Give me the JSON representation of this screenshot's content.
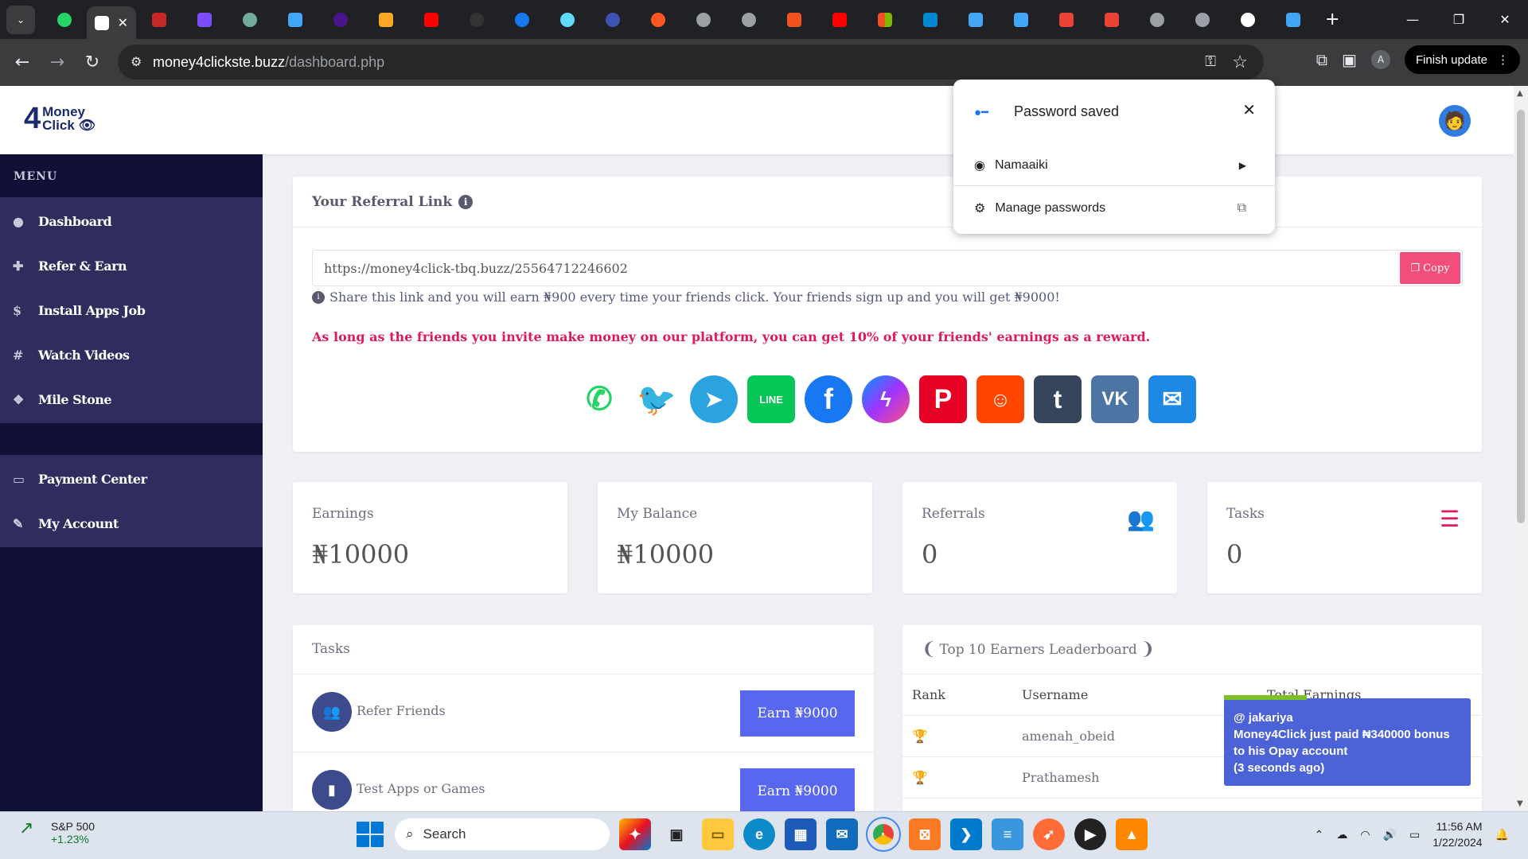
{
  "browser": {
    "active_tab_close": "✕",
    "url_host": "money4clickste.buzz",
    "url_path": "/dashboard.php",
    "profile_initial": "A",
    "finish_update_label": "Finish update"
  },
  "site": {
    "logo_number": "4",
    "logo_word1": "Money",
    "logo_word2": "Click"
  },
  "sidebar": {
    "menu_label": "MENU",
    "items": [
      {
        "label": "Dashboard",
        "icon": "user-circle-icon"
      },
      {
        "label": "Refer & Earn",
        "icon": "user-plus-icon"
      },
      {
        "label": "Install Apps Job",
        "icon": "dollar-icon"
      },
      {
        "label": "Watch Videos",
        "icon": "hash-icon"
      },
      {
        "label": "Mile Stone",
        "icon": "gift-icon"
      }
    ],
    "items2": [
      {
        "label": "Payment Center",
        "icon": "payment-icon"
      },
      {
        "label": "My Account",
        "icon": "wrench-icon"
      }
    ]
  },
  "referral": {
    "title": "Your Referral Link",
    "link": "https://money4click-tbq.buzz/25564712246602",
    "copy_label": "Copy",
    "note": "Share this link and you will earn ₦900 every time your friends click. Your friends sign up and you will get ₦9000!",
    "promo": "As long as the friends you invite make money on our platform, you can get 10% of your friends' earnings as a reward."
  },
  "stats": [
    {
      "label": "Earnings",
      "value": "₦10000"
    },
    {
      "label": "My Balance",
      "value": "₦10000"
    },
    {
      "label": "Referrals",
      "value": "0"
    },
    {
      "label": "Tasks",
      "value": "0"
    }
  ],
  "tasks": {
    "title": "Tasks",
    "rows": [
      {
        "name": "Refer Friends",
        "button": "Earn ₦9000"
      },
      {
        "name": "Test Apps or Games",
        "button": "Earn ₦9000"
      }
    ]
  },
  "leaderboard": {
    "title": "Top 10 Earners Leaderboard",
    "col_rank": "Rank",
    "col_user": "Username",
    "col_total": "Total Earnings",
    "rows": [
      {
        "user": "amenah_obeid"
      },
      {
        "user": "Prathamesh"
      }
    ]
  },
  "toast": {
    "line1": "@ jakariya",
    "line2": "Money4Click just paid ₦340000 bonus to his Opay account",
    "line3": "(3 seconds ago)"
  },
  "password_popup": {
    "title": "Password saved",
    "account": "Namaaiki",
    "manage": "Manage passwords"
  },
  "taskbar": {
    "stock_name": "S&P 500",
    "stock_change": "+1.23%",
    "search_placeholder": "Search",
    "time": "11:56 AM",
    "date": "1/22/2024"
  },
  "colors": {
    "sidebar_bg": "#111036",
    "accent_pink": "#f14e7c",
    "button_blue": "#5867f0",
    "promo_red": "#e0195a"
  }
}
